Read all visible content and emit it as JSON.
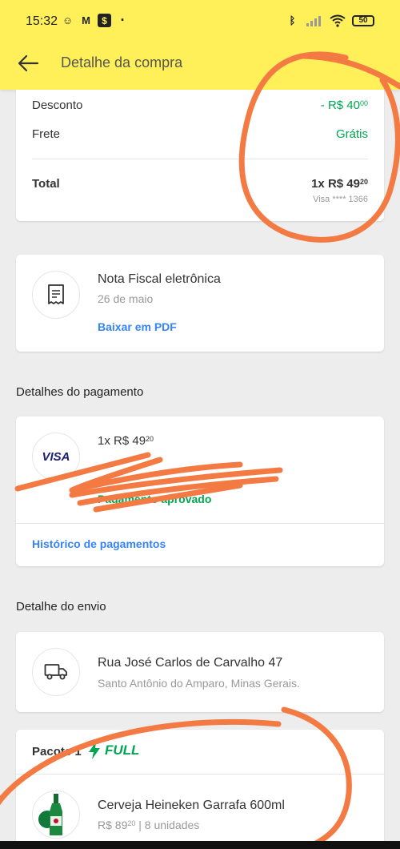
{
  "status": {
    "time": "15:32",
    "battery": "50"
  },
  "header": {
    "title": "Detalhe da compra"
  },
  "summary": {
    "discount_label": "Desconto",
    "discount_value": "- R$ 40",
    "discount_cents": "00",
    "shipping_label": "Frete",
    "shipping_value": "Grátis",
    "total_label": "Total",
    "total_value": "1x R$ 49",
    "total_cents": "20",
    "total_card": "Visa **** 1366"
  },
  "invoice": {
    "title": "Nota Fiscal eletrônica",
    "date": "26 de maio",
    "download_link": "Baixar em PDF"
  },
  "payment": {
    "section_title": "Detalhes do pagamento",
    "amount": "1x R$ 49",
    "amount_cents": "20",
    "card_brand": "VISA",
    "status": "Pagamento aprovado",
    "history_link": "Histórico de pagamentos"
  },
  "shipping": {
    "section_title": "Detalhe do envio",
    "address_line1": "Rua José Carlos de Carvalho 47",
    "address_line2": "Santo Antônio do Amparo, Minas Gerais."
  },
  "package": {
    "label": "Pacote 1",
    "badge": "FULL",
    "product_name": "Cerveja Heineken Garrafa 600ml",
    "product_price": "R$ 89",
    "product_price_cents": "20",
    "product_qty": "| 8 unidades"
  },
  "colors": {
    "brand_yellow": "#fff059",
    "green": "#00a650",
    "link_blue": "#3483fa",
    "scribble_orange": "#f47a44"
  }
}
